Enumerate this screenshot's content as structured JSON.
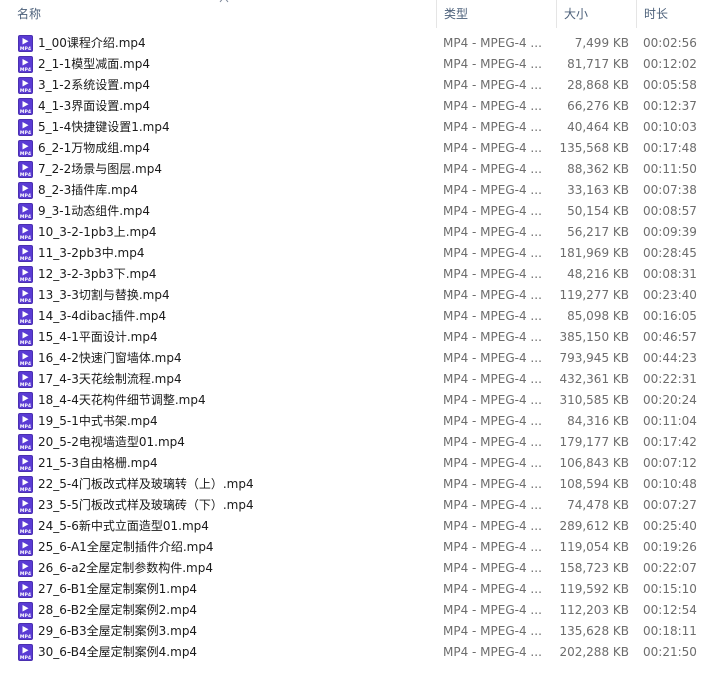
{
  "columns": {
    "name": "名称",
    "type": "类型",
    "size": "大小",
    "duration": "时长"
  },
  "icon": "mp4-video-file-icon",
  "files": [
    {
      "name": "1_00课程介绍.mp4",
      "type": "MP4 - MPEG-4 ...",
      "size": "7,499 KB",
      "duration": "00:02:56"
    },
    {
      "name": "2_1-1模型减面.mp4",
      "type": "MP4 - MPEG-4 ...",
      "size": "81,717 KB",
      "duration": "00:12:02"
    },
    {
      "name": "3_1-2系统设置.mp4",
      "type": "MP4 - MPEG-4 ...",
      "size": "28,868 KB",
      "duration": "00:05:58"
    },
    {
      "name": "4_1-3界面设置.mp4",
      "type": "MP4 - MPEG-4 ...",
      "size": "66,276 KB",
      "duration": "00:12:37"
    },
    {
      "name": "5_1-4快捷键设置1.mp4",
      "type": "MP4 - MPEG-4 ...",
      "size": "40,464 KB",
      "duration": "00:10:03"
    },
    {
      "name": "6_2-1万物成组.mp4",
      "type": "MP4 - MPEG-4 ...",
      "size": "135,568 KB",
      "duration": "00:17:48"
    },
    {
      "name": "7_2-2场景与图层.mp4",
      "type": "MP4 - MPEG-4 ...",
      "size": "88,362 KB",
      "duration": "00:11:50"
    },
    {
      "name": "8_2-3插件库.mp4",
      "type": "MP4 - MPEG-4 ...",
      "size": "33,163 KB",
      "duration": "00:07:38"
    },
    {
      "name": "9_3-1动态组件.mp4",
      "type": "MP4 - MPEG-4 ...",
      "size": "50,154 KB",
      "duration": "00:08:57"
    },
    {
      "name": "10_3-2-1pb3上.mp4",
      "type": "MP4 - MPEG-4 ...",
      "size": "56,217 KB",
      "duration": "00:09:39"
    },
    {
      "name": "11_3-2pb3中.mp4",
      "type": "MP4 - MPEG-4 ...",
      "size": "181,969 KB",
      "duration": "00:28:45"
    },
    {
      "name": "12_3-2-3pb3下.mp4",
      "type": "MP4 - MPEG-4 ...",
      "size": "48,216 KB",
      "duration": "00:08:31"
    },
    {
      "name": "13_3-3切割与替换.mp4",
      "type": "MP4 - MPEG-4 ...",
      "size": "119,277 KB",
      "duration": "00:23:40"
    },
    {
      "name": "14_3-4dibac插件.mp4",
      "type": "MP4 - MPEG-4 ...",
      "size": "85,098 KB",
      "duration": "00:16:05"
    },
    {
      "name": "15_4-1平面设计.mp4",
      "type": "MP4 - MPEG-4 ...",
      "size": "385,150 KB",
      "duration": "00:46:57"
    },
    {
      "name": "16_4-2快速门窗墙体.mp4",
      "type": "MP4 - MPEG-4 ...",
      "size": "793,945 KB",
      "duration": "00:44:23"
    },
    {
      "name": "17_4-3天花绘制流程.mp4",
      "type": "MP4 - MPEG-4 ...",
      "size": "432,361 KB",
      "duration": "00:22:31"
    },
    {
      "name": "18_4-4天花构件细节调整.mp4",
      "type": "MP4 - MPEG-4 ...",
      "size": "310,585 KB",
      "duration": "00:20:24"
    },
    {
      "name": "19_5-1中式书架.mp4",
      "type": "MP4 - MPEG-4 ...",
      "size": "84,316 KB",
      "duration": "00:11:04"
    },
    {
      "name": "20_5-2电视墙造型01.mp4",
      "type": "MP4 - MPEG-4 ...",
      "size": "179,177 KB",
      "duration": "00:17:42"
    },
    {
      "name": "21_5-3自由格栅.mp4",
      "type": "MP4 - MPEG-4 ...",
      "size": "106,843 KB",
      "duration": "00:07:12"
    },
    {
      "name": "22_5-4门板改式样及玻璃转（上）.mp4",
      "type": "MP4 - MPEG-4 ...",
      "size": "108,594 KB",
      "duration": "00:10:48"
    },
    {
      "name": "23_5-5门板改式样及玻璃砖（下）.mp4",
      "type": "MP4 - MPEG-4 ...",
      "size": "74,478 KB",
      "duration": "00:07:27"
    },
    {
      "name": "24_5-6新中式立面造型01.mp4",
      "type": "MP4 - MPEG-4 ...",
      "size": "289,612 KB",
      "duration": "00:25:40"
    },
    {
      "name": "25_6-A1全屋定制插件介绍.mp4",
      "type": "MP4 - MPEG-4 ...",
      "size": "119,054 KB",
      "duration": "00:19:26"
    },
    {
      "name": "26_6-a2全屋定制参数构件.mp4",
      "type": "MP4 - MPEG-4 ...",
      "size": "158,723 KB",
      "duration": "00:22:07"
    },
    {
      "name": "27_6-B1全屋定制案例1.mp4",
      "type": "MP4 - MPEG-4 ...",
      "size": "119,592 KB",
      "duration": "00:15:10"
    },
    {
      "name": "28_6-B2全屋定制案例2.mp4",
      "type": "MP4 - MPEG-4 ...",
      "size": "112,203 KB",
      "duration": "00:12:54"
    },
    {
      "name": "29_6-B3全屋定制案例3.mp4",
      "type": "MP4 - MPEG-4 ...",
      "size": "135,628 KB",
      "duration": "00:18:11"
    },
    {
      "name": "30_6-B4全屋定制案例4.mp4",
      "type": "MP4 - MPEG-4 ...",
      "size": "202,288 KB",
      "duration": "00:21:50"
    }
  ]
}
